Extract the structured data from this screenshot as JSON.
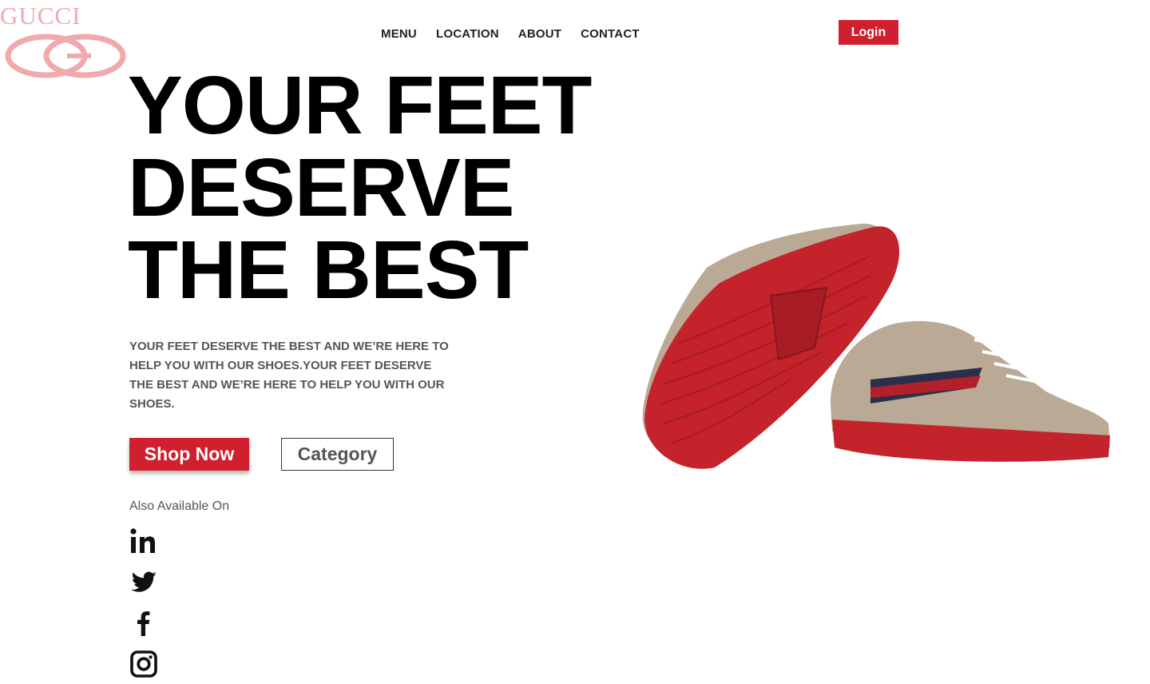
{
  "brand": {
    "name": "GUCCI",
    "logo_color": "#f0a9ad"
  },
  "nav": {
    "items": [
      "MENU",
      "LOCATION",
      "ABOUT",
      "CONTACT"
    ]
  },
  "login": {
    "label": "Login"
  },
  "hero": {
    "title_lines": [
      "YOUR FEET",
      "DESERVE",
      "THE BEST"
    ],
    "description": "YOUR FEET DESERVE THE BEST AND WE’RE HERE TO HELP YOU WITH OUR SHOES.YOUR FEET DESERVE THE BEST AND WE’RE HERE TO HELP YOU WITH OUR SHOES.",
    "primary_button": "Shop Now",
    "secondary_button": "Category"
  },
  "social": {
    "heading": "Also Available On",
    "icons": [
      "linkedin-icon",
      "twitter-icon",
      "facebook-icon",
      "instagram-icon"
    ]
  },
  "colors": {
    "accent": "#d01f2e",
    "text": "#000000",
    "muted": "#555555"
  }
}
